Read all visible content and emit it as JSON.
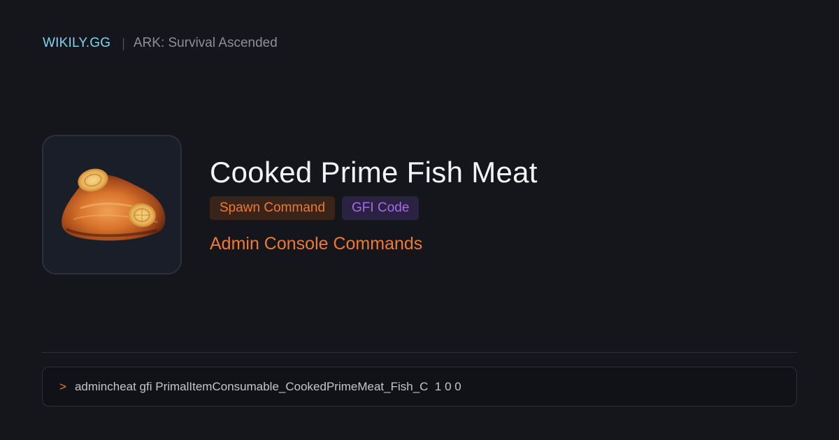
{
  "header": {
    "brand": "WIKILY.GG",
    "separator": "|",
    "game": "ARK: Survival Ascended"
  },
  "item": {
    "icon": "cooked-fish-meat-icon",
    "title": "Cooked Prime Fish Meat",
    "tags": [
      {
        "label": "Spawn Command",
        "color": "#ee7a2f"
      },
      {
        "label": "GFI Code",
        "color": "#a76ae8"
      }
    ],
    "subtitle": "Admin Console Commands"
  },
  "command": {
    "prompt": ">",
    "text": "admincheat gfi PrimalItemConsumable_CookedPrimeMeat_Fish_C  1 0 0"
  },
  "colors": {
    "background": "#15161b",
    "accent": "#ee7a2f",
    "brand": "#7fd3ee",
    "gfi": "#a76ae8"
  }
}
